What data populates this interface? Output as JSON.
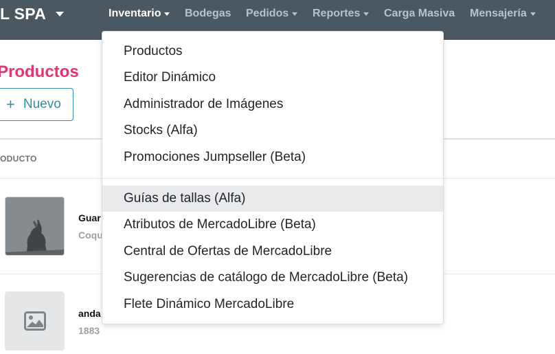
{
  "navbar": {
    "brand": "L SPA",
    "items": [
      {
        "label": "Inventario",
        "caret": true,
        "active": true
      },
      {
        "label": "Bodegas",
        "caret": false,
        "active": false
      },
      {
        "label": "Pedidos",
        "caret": true,
        "active": false
      },
      {
        "label": "Reportes",
        "caret": true,
        "active": false
      },
      {
        "label": "Carga Masiva",
        "caret": false,
        "active": false
      },
      {
        "label": "Mensajería",
        "caret": true,
        "active": false
      }
    ]
  },
  "page": {
    "title": "Productos",
    "new_button": {
      "icon": "plus-icon",
      "label": "Nuevo"
    },
    "column_header": "ODUCTO"
  },
  "rows": [
    {
      "name": "Guar",
      "sub": "Coqu",
      "thumb": "photo"
    },
    {
      "name": "anda",
      "sub": "1883",
      "thumb": "image-placeholder-icon"
    }
  ],
  "dropdown": {
    "menu": "Inventario",
    "group1": [
      {
        "label": "Productos"
      },
      {
        "label": "Editor Dinámico"
      },
      {
        "label": "Administrador de Imágenes"
      },
      {
        "label": "Stocks (Alfa)"
      },
      {
        "label": "Promociones Jumpseller (Beta)"
      }
    ],
    "group2": [
      {
        "label": "Guías de tallas (Alfa)",
        "hover": true
      },
      {
        "label": "Atributos de MercadoLibre (Beta)"
      },
      {
        "label": "Central de Ofertas de MercadoLibre"
      },
      {
        "label": "Sugerencias de catálogo de MercadoLibre (Beta)"
      },
      {
        "label": "Flete Dinámico MercadoLibre"
      }
    ]
  },
  "colors": {
    "navbar_bg": "#4a5961",
    "title_pink": "#e8336f",
    "accent_teal": "#2f8ea3",
    "hover_bg": "#e8eaec"
  }
}
